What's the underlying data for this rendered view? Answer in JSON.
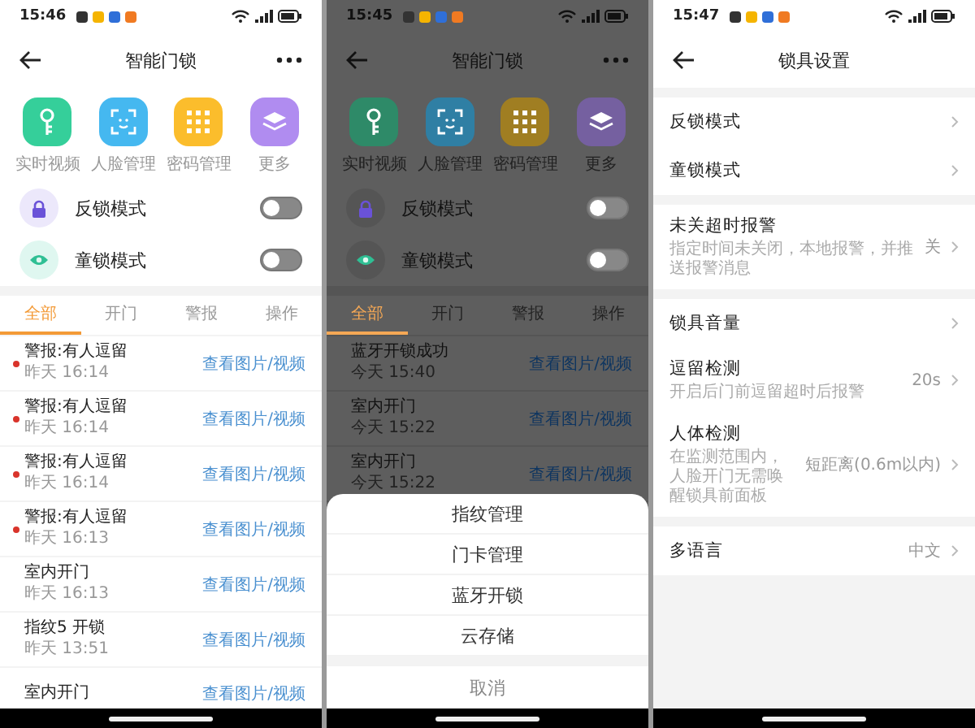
{
  "panels": [
    {
      "kind": "lock_home",
      "dimmed": false,
      "status_time": "15:46",
      "title": "智能门锁",
      "shortcuts": [
        {
          "label": "实时视频",
          "color": "#35cf9a"
        },
        {
          "label": "人脸管理",
          "color": "#45b8f0"
        },
        {
          "label": "密码管理",
          "color": "#fbbd2c"
        },
        {
          "label": "更多",
          "color": "#b08cf0"
        }
      ],
      "modes": [
        {
          "label": "反锁模式",
          "on": false
        },
        {
          "label": "童锁模式",
          "on": false
        }
      ],
      "tabs": [
        {
          "label": "全部",
          "selected": true
        },
        {
          "label": "开门",
          "selected": false
        },
        {
          "label": "警报",
          "selected": false
        },
        {
          "label": "操作",
          "selected": false
        }
      ],
      "events": [
        {
          "title": "警报:有人逗留",
          "time": "昨天 16:14",
          "link": "查看图片/视频",
          "alarm": true
        },
        {
          "title": "警报:有人逗留",
          "time": "昨天 16:14",
          "link": "查看图片/视频",
          "alarm": true
        },
        {
          "title": "警报:有人逗留",
          "time": "昨天 16:14",
          "link": "查看图片/视频",
          "alarm": true
        },
        {
          "title": "警报:有人逗留",
          "time": "昨天 16:13",
          "link": "查看图片/视频",
          "alarm": true
        },
        {
          "title": "室内开门",
          "time": "昨天 16:13",
          "link": "查看图片/视频",
          "alarm": false
        },
        {
          "title": "指纹5 开锁",
          "time": "昨天 13:51",
          "link": "查看图片/视频",
          "alarm": false
        },
        {
          "title": "室内开门",
          "link": "查看图片/视频",
          "alarm": false
        }
      ]
    },
    {
      "kind": "lock_home",
      "dimmed": true,
      "status_time": "15:45",
      "title": "智能门锁",
      "shortcuts": [
        {
          "label": "实时视频",
          "color": "#2e8a68"
        },
        {
          "label": "人脸管理",
          "color": "#2f7fa4"
        },
        {
          "label": "密码管理",
          "color": "#a07e22"
        },
        {
          "label": "更多",
          "color": "#7560a0"
        }
      ],
      "modes": [
        {
          "label": "反锁模式",
          "on": false
        },
        {
          "label": "童锁模式",
          "on": false
        }
      ],
      "tabs": [
        {
          "label": "全部",
          "selected": true
        },
        {
          "label": "开门",
          "selected": false
        },
        {
          "label": "警报",
          "selected": false
        },
        {
          "label": "操作",
          "selected": false
        }
      ],
      "events": [
        {
          "title": "蓝牙开锁成功",
          "time": "今天 15:40",
          "link": "查看图片/视频",
          "alarm": false
        },
        {
          "title": "室内开门",
          "time": "今天 15:22",
          "link": "查看图片/视频",
          "alarm": false
        },
        {
          "title": "室内开门",
          "time": "今天 15:22",
          "link": "查看图片/视频",
          "alarm": false
        }
      ],
      "sheet": {
        "items": [
          "指纹管理",
          "门卡管理",
          "蓝牙开锁",
          "云存储"
        ],
        "cancel": "取消"
      }
    },
    {
      "kind": "settings",
      "status_time": "15:47",
      "title": "锁具设置",
      "groups": [
        [
          {
            "label": "反锁模式"
          },
          {
            "label": "童锁模式"
          }
        ],
        [
          {
            "label": "未关超时报警",
            "hint": "指定时间未关闭，本地报警，并推送报警消息",
            "value": "关"
          }
        ],
        [
          {
            "label": "锁具音量"
          },
          {
            "label": "逗留检测",
            "hint": "开启后门前逗留超时后报警",
            "value": "20s"
          },
          {
            "label": "人体检测",
            "hint": "在监测范围内，人脸开门无需唤醒锁具前面板",
            "value": "短距离(0.6m以内)"
          }
        ],
        [
          {
            "label": "多语言",
            "value": "中文"
          }
        ]
      ]
    }
  ]
}
